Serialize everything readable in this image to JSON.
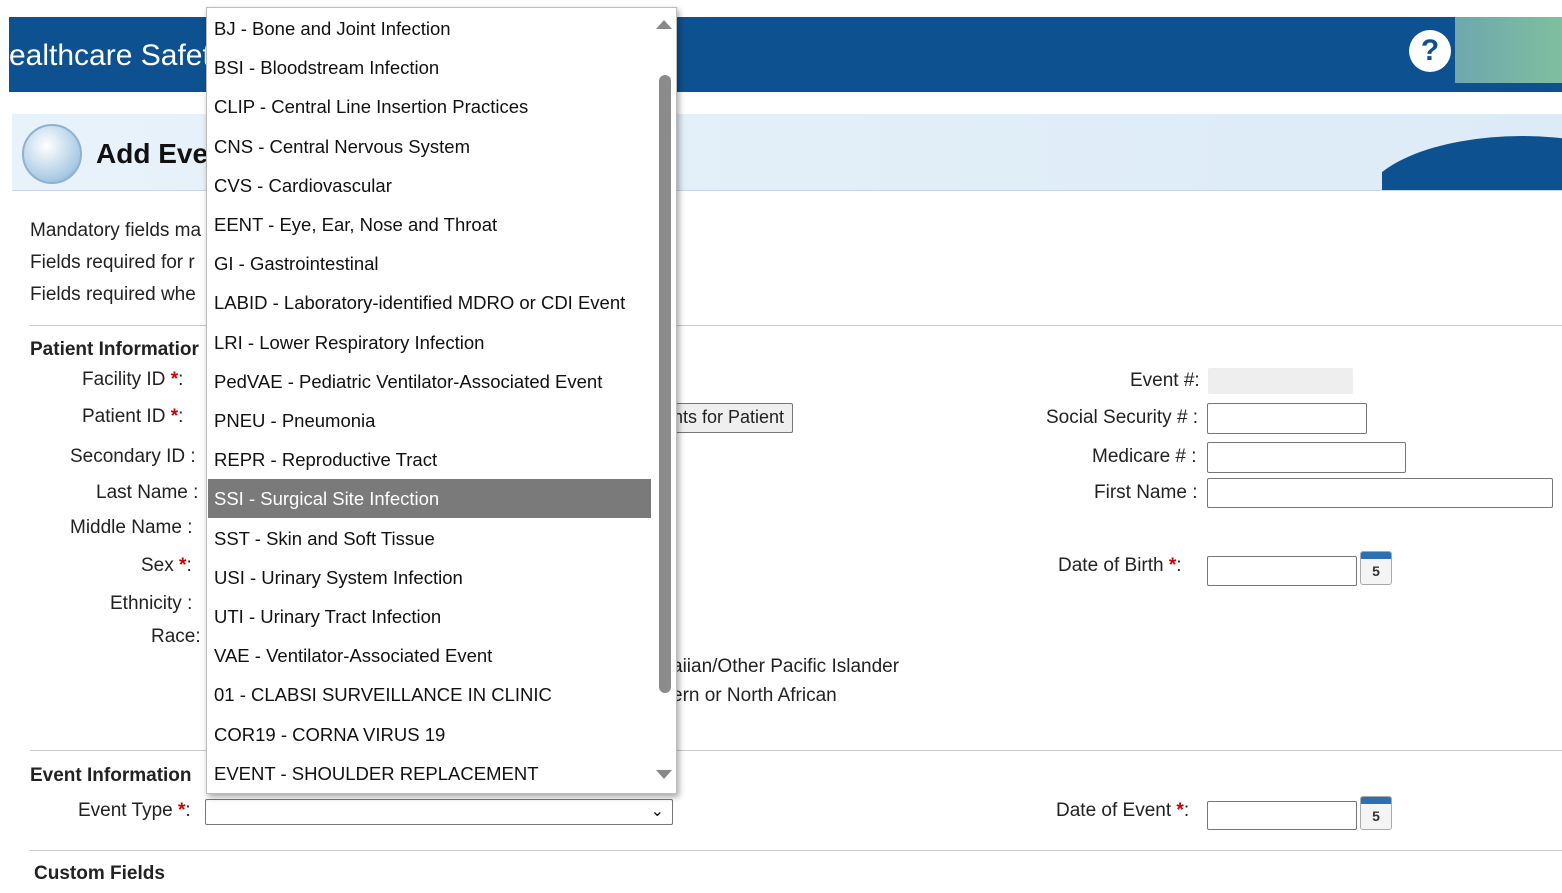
{
  "header": {
    "title": "ealthcare Safety",
    "help_icon": "help-icon"
  },
  "page": {
    "title": "Add Eve"
  },
  "notes": [
    "Mandatory fields ma",
    "Fields required for r",
    "Fields required whe"
  ],
  "patient_section": {
    "heading": "Patient Informatior",
    "facility_id_label": "Facility ID",
    "patient_id_label": "Patient ID",
    "find_events_button": "nts for Patient",
    "secondary_id_label": "Secondary ID",
    "last_name_label": "Last Name",
    "middle_name_label": "Middle Name",
    "sex_label": "Sex",
    "ethnicity_label": "Ethnicity",
    "race_label": "Race:",
    "race_options_visible": [
      "aiian/Other Pacific Islander",
      "ern or North African"
    ],
    "event_num_label": "Event #:",
    "ssn_label": "Social Security #",
    "medicare_label": "Medicare #",
    "first_name_label": "First Name",
    "dob_label": "Date of Birth",
    "calendar_day": "5"
  },
  "event_section": {
    "heading": "Event Information",
    "event_type_label": "Event Type",
    "event_type_value": "",
    "date_of_event_label": "Date of Event",
    "calendar_day": "5"
  },
  "custom_section": {
    "heading": "Custom Fields"
  },
  "colon": ":",
  "required_mark": "*",
  "dropdown": {
    "selected_index": 12,
    "options": [
      "BJ - Bone and Joint Infection",
      "BSI - Bloodstream Infection",
      "CLIP - Central Line Insertion Practices",
      "CNS - Central Nervous System",
      "CVS - Cardiovascular",
      "EENT - Eye, Ear, Nose and Throat",
      "GI - Gastrointestinal",
      "LABID - Laboratory-identified MDRO or CDI Event",
      "LRI - Lower Respiratory Infection",
      "PedVAE - Pediatric Ventilator-Associated Event",
      "PNEU - Pneumonia",
      "REPR - Reproductive Tract",
      "SSI - Surgical Site Infection",
      "SST - Skin and Soft Tissue",
      "USI - Urinary System Infection",
      "UTI - Urinary Tract Infection",
      "VAE - Ventilator-Associated Event",
      "01 - CLABSI SURVEILLANCE IN CLINIC",
      "COR19 - CORNA VIRUS 19",
      "EVENT - SHOULDER REPLACEMENT"
    ]
  },
  "colors": {
    "header_bg": "#0d5190",
    "selected_option_bg": "#7a7a7a",
    "required": "#cc0000"
  }
}
